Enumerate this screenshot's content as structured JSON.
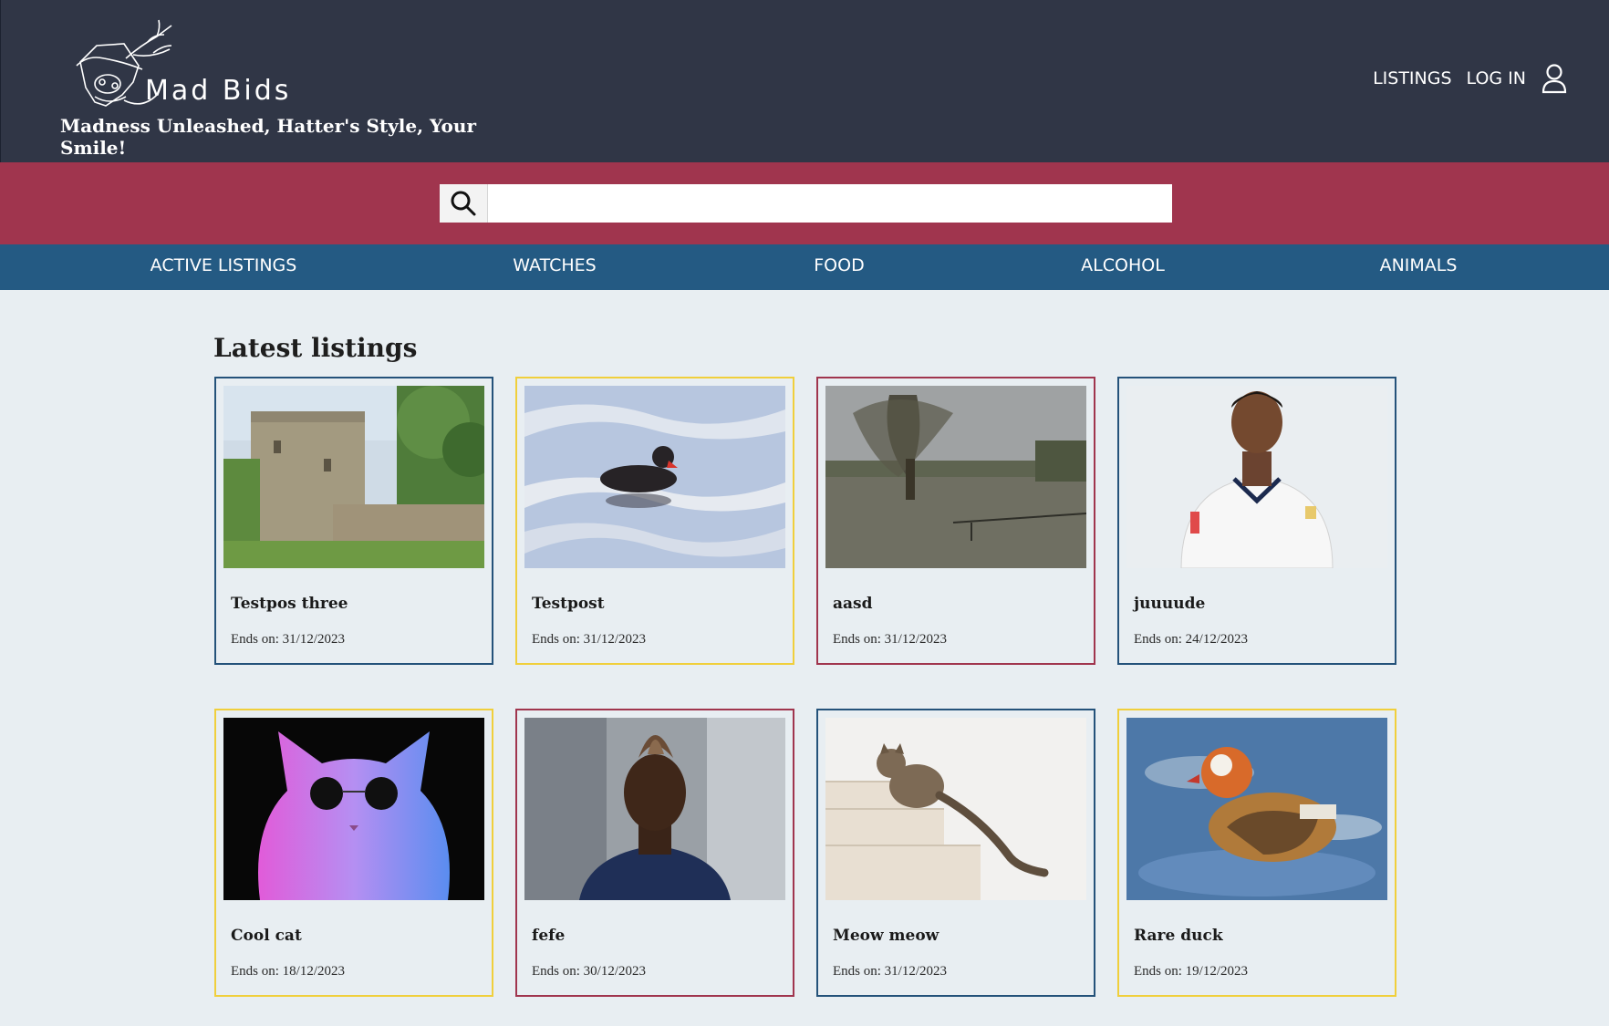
{
  "header": {
    "brand": "Mad Bids",
    "tagline": "Madness Unleashed, Hatter's Style, Your Smile!",
    "nav": {
      "listings": "LISTINGS",
      "login": "LOG IN"
    }
  },
  "search": {
    "value": "",
    "placeholder": ""
  },
  "categories": [
    "ACTIVE LISTINGS",
    "WATCHES",
    "FOOD",
    "ALCOHOL",
    "ANIMALS"
  ],
  "main": {
    "title": "Latest listings",
    "listings": [
      {
        "title": "Testpos three",
        "ends": "Ends on: 31/12/2023",
        "image": "castle-tower-photo"
      },
      {
        "title": "Testpost",
        "ends": "Ends on: 31/12/2023",
        "image": "moorhen-on-water-photo"
      },
      {
        "title": "aasd",
        "ends": "Ends on: 31/12/2023",
        "image": "flooded-field-willow-photo"
      },
      {
        "title": "juuuude",
        "ends": "Ends on: 24/12/2023",
        "image": "football-player-portrait-photo"
      },
      {
        "title": "Cool cat",
        "ends": "Ends on: 18/12/2023",
        "image": "neon-cat-sunglasses-photo"
      },
      {
        "title": "fefe",
        "ends": "Ends on: 30/12/2023",
        "image": "football-player-mohawk-photo"
      },
      {
        "title": "Meow meow",
        "ends": "Ends on: 31/12/2023",
        "image": "cat-on-stairs-photo"
      },
      {
        "title": "Rare duck",
        "ends": "Ends on: 19/12/2023",
        "image": "mandarin-duck-photo"
      }
    ]
  },
  "colors": {
    "header_bg": "#303646",
    "search_band": "#a0354e",
    "category_bar": "#245a83",
    "page_bg": "#e8eef2",
    "card_blue": "#24527a",
    "card_yellow": "#f0cf3c",
    "card_red": "#a0354e"
  }
}
